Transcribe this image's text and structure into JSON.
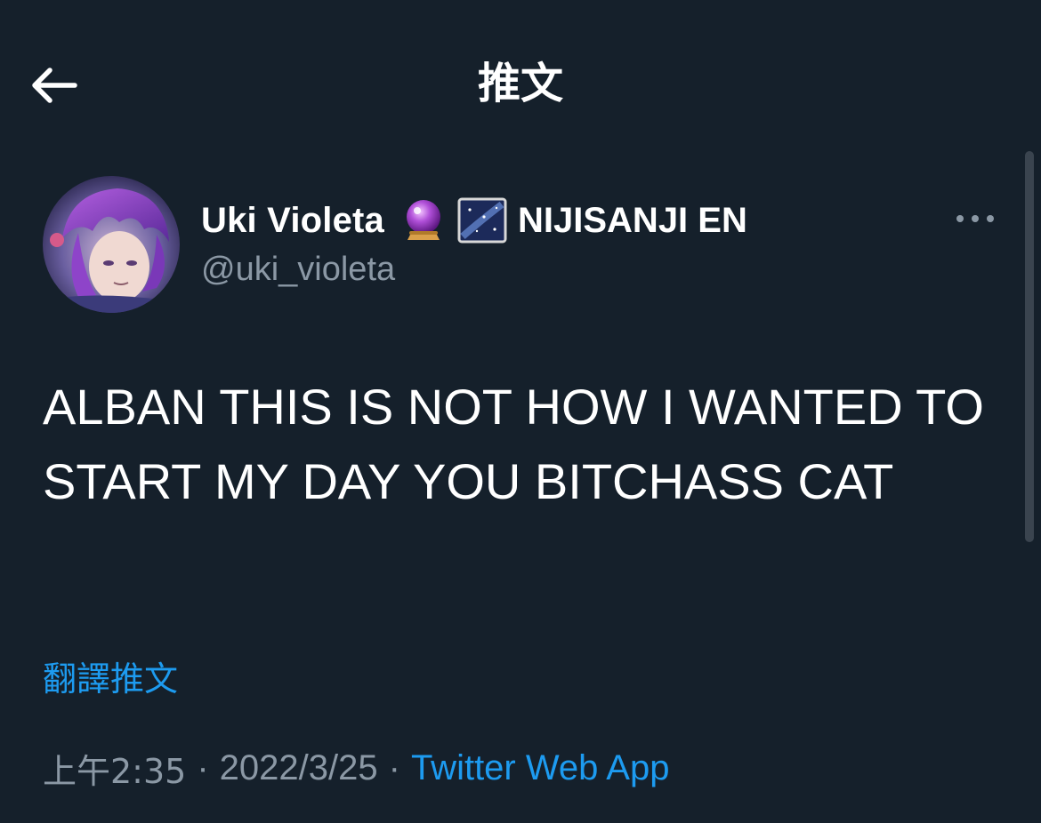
{
  "header": {
    "title": "推文",
    "back_icon": "arrow-left-icon"
  },
  "tweet": {
    "author": {
      "display_name": "Uki Violeta",
      "name_emojis": [
        "crystal-ball-emoji",
        "milky-way-emoji"
      ],
      "org_name": "NIJISANJI EN",
      "handle": "@uki_violeta",
      "avatar": "profile-avatar"
    },
    "more_icon": "more-horizontal-icon",
    "text": "ALBAN THIS IS NOT HOW I WANTED TO START MY DAY YOU BITCHASS CAT",
    "translate_label": "翻譯推文",
    "meta": {
      "time": "上午2:35",
      "separator": "·",
      "date": "2022/3/25",
      "source": "Twitter Web App"
    }
  },
  "colors": {
    "background": "#15202b",
    "primary_text": "#ffffff",
    "secondary_text": "#8b98a5",
    "link": "#1d9bf0",
    "scrollbar": "#3a444f"
  }
}
